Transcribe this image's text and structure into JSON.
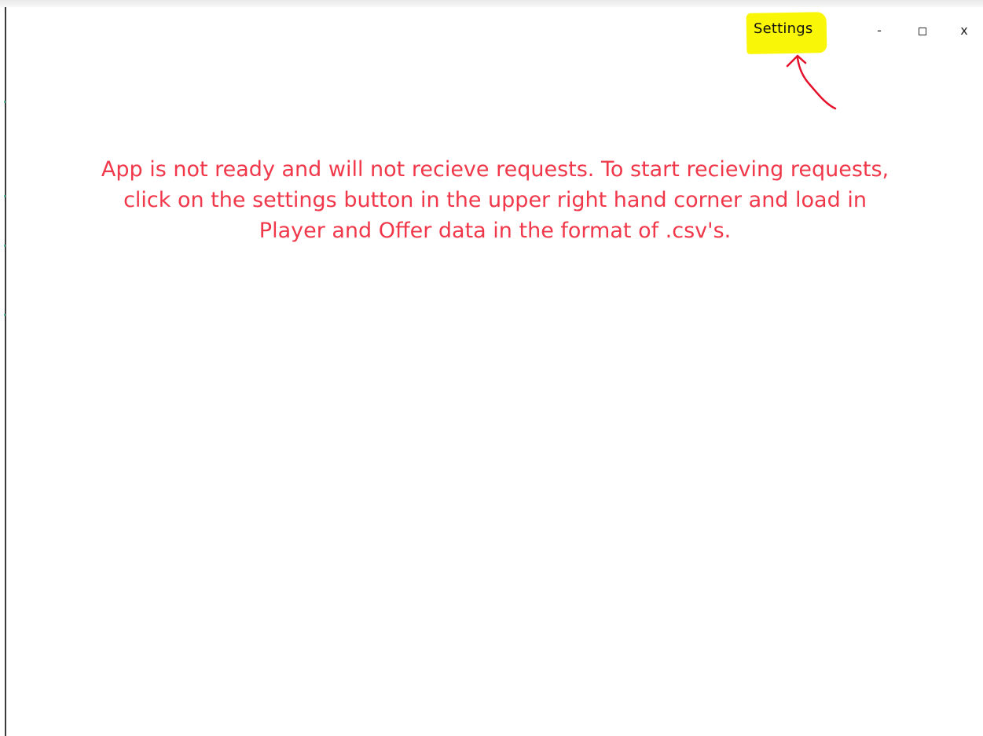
{
  "titlebar": {
    "settings_label": "Settings",
    "minimize_label": "-",
    "maximize_icon": "square-icon",
    "close_label": "x"
  },
  "main": {
    "status_message": "App is not ready and will not recieve requests. To start recieving requests,\nclick on the settings button in the upper right hand corner and load in\nPlayer and Offer data in the format of .csv's."
  },
  "colors": {
    "message_red": "#f0384a",
    "highlight_yellow": "#faf608",
    "annotation_red": "#e5102a"
  }
}
